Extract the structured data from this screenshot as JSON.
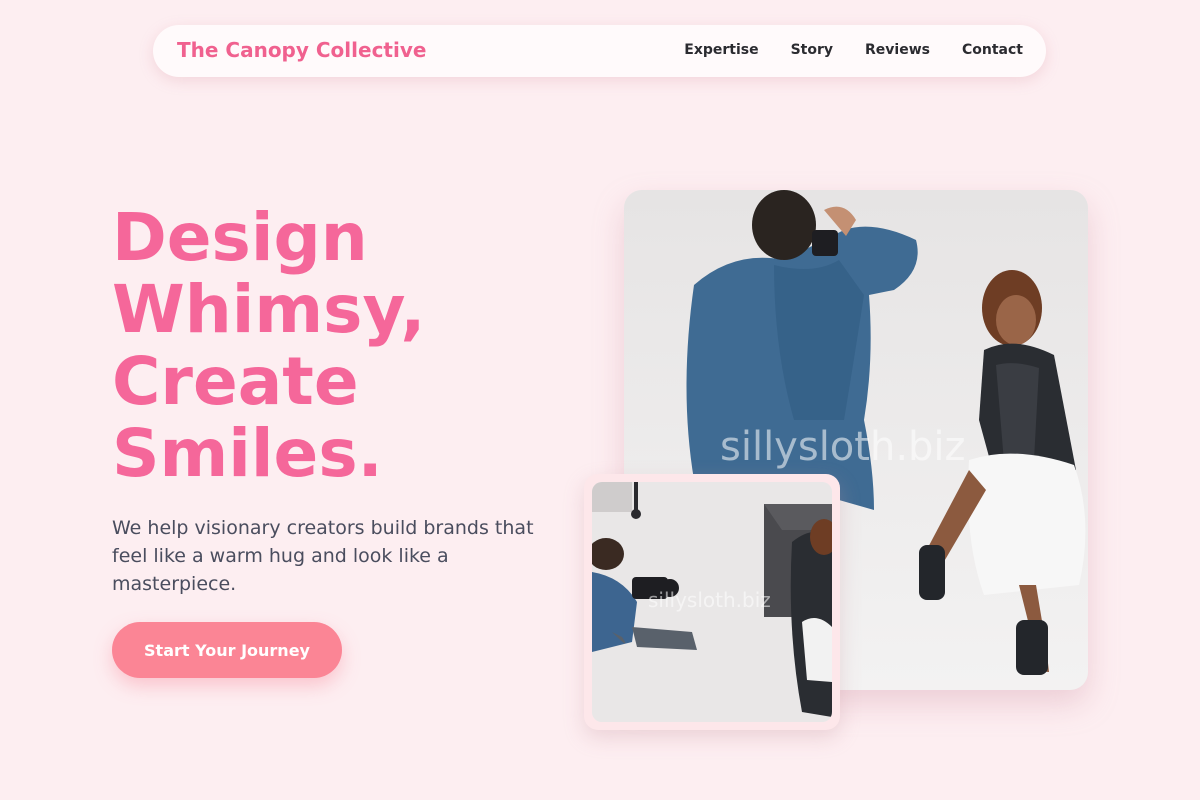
{
  "header": {
    "brand": "The Canopy Collective",
    "nav": [
      "Expertise",
      "Story",
      "Reviews",
      "Contact"
    ]
  },
  "hero": {
    "title_lines": [
      "Design",
      "Whimsy,",
      "Create",
      "Smiles."
    ],
    "subtitle": "We help visionary creators build brands that feel like a warm hug and look like a masterpiece.",
    "cta": "Start Your Journey"
  },
  "images": {
    "watermark": "sillysloth.biz"
  },
  "colors": {
    "background": "#fdeef1",
    "accent": "#f0618f",
    "cta": "#fb8595"
  }
}
